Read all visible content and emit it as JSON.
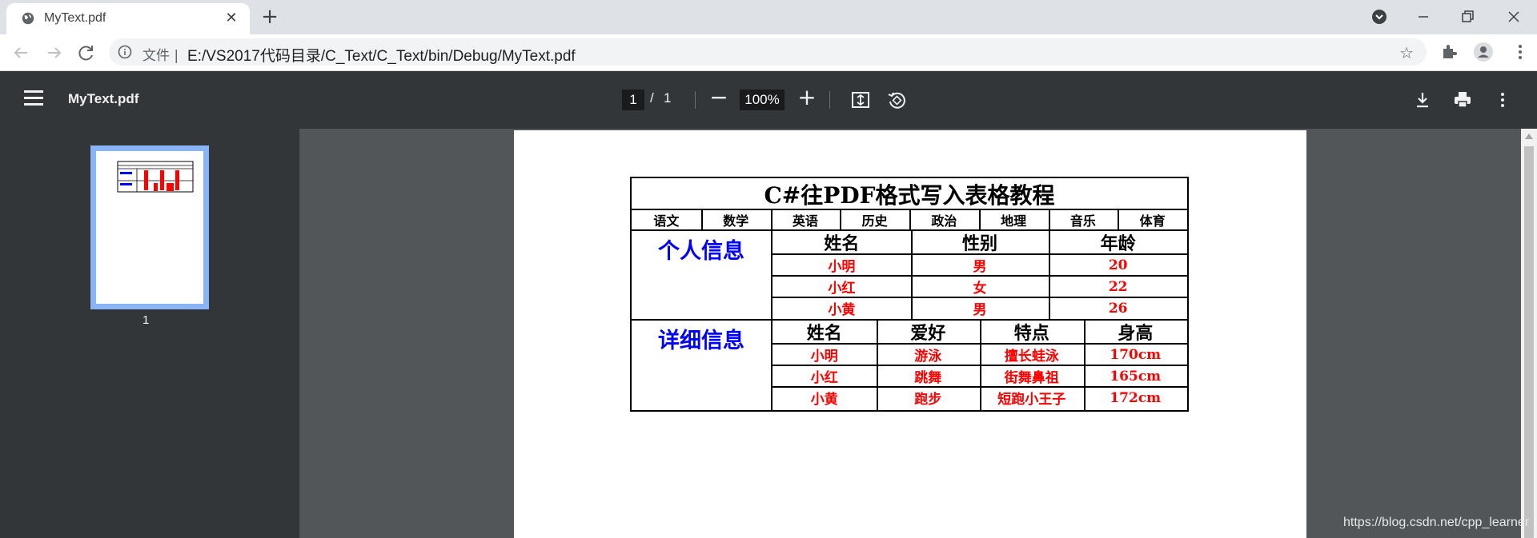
{
  "browser": {
    "tab_title": "MyText.pdf",
    "tab_close": "✕",
    "new_tab": "+",
    "address_scheme": "文件 |",
    "address_url": "E:/VS2017代码目录/C_Text/C_Text/bin/Debug/MyText.pdf"
  },
  "pdf_toolbar": {
    "title": "MyText.pdf",
    "page_current": "1",
    "page_separator": "/",
    "page_total": "1",
    "zoom": "100%"
  },
  "sidebar": {
    "thumbnail_label": "1"
  },
  "document": {
    "title": "C#往PDF格式写入表格教程",
    "subjects": [
      "语文",
      "数学",
      "英语",
      "历史",
      "政治",
      "地理",
      "音乐",
      "体育"
    ],
    "personal": {
      "label": "个人信息",
      "headers": [
        "姓名",
        "性别",
        "年龄"
      ],
      "rows": [
        [
          "小明",
          "男",
          "20"
        ],
        [
          "小红",
          "女",
          "22"
        ],
        [
          "小黄",
          "男",
          "26"
        ]
      ]
    },
    "detail": {
      "label": "详细信息",
      "headers": [
        "姓名",
        "爱好",
        "特点",
        "身高"
      ],
      "rows": [
        [
          "小明",
          "游泳",
          "擅长蛙泳",
          "170cm"
        ],
        [
          "小红",
          "跳舞",
          "街舞鼻祖",
          "165cm"
        ],
        [
          "小黄",
          "跑步",
          "短跑小王子",
          "172cm"
        ]
      ]
    }
  },
  "watermark": "https://blog.csdn.net/cpp_learner",
  "colors": {
    "header_text": "#000000",
    "value_text": "#ff0000",
    "section_label": "#0000ff",
    "toolbar_bg": "#323639",
    "canvas_bg": "#525659"
  }
}
